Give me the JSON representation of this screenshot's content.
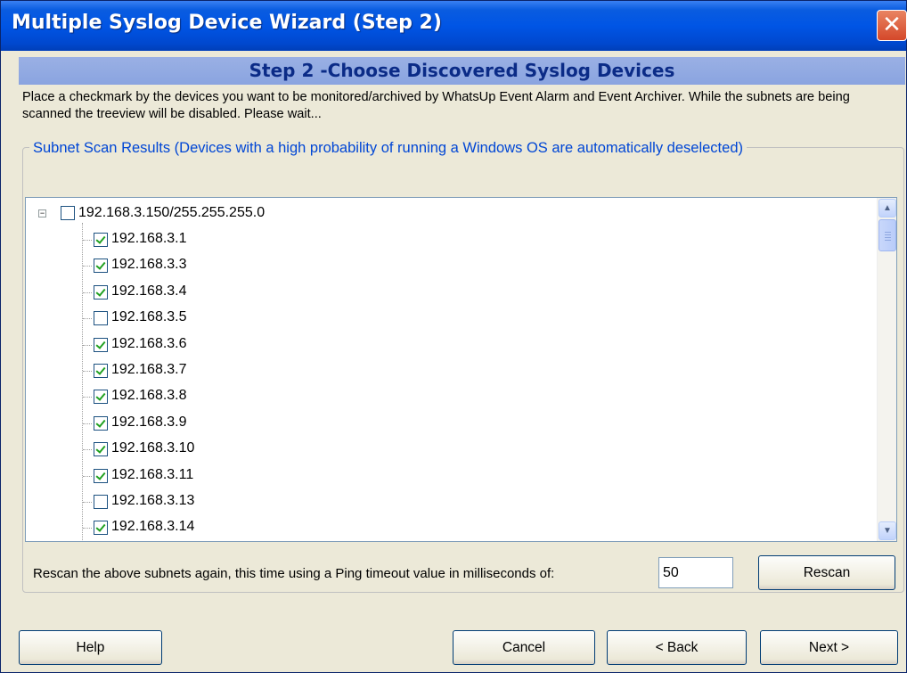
{
  "window": {
    "title": "Multiple Syslog Device Wizard (Step 2)",
    "close_glyph": "✕"
  },
  "step_banner": "Step 2 -Choose Discovered Syslog Devices",
  "instructions": "Place a checkmark by the devices you want to be monitored/archived by WhatsUp Event Alarm and Event Archiver. While the subnets are being scanned the treeview will be disabled.  Please wait...",
  "group": {
    "label": "Subnet Scan Results (Devices with a high probability of running a Windows OS are automatically deselected)"
  },
  "tree": {
    "root": {
      "label": "192.168.3.150/255.255.255.0",
      "checked": false,
      "expander": "⊟"
    },
    "devices": [
      {
        "ip": "192.168.3.1",
        "checked": true
      },
      {
        "ip": "192.168.3.3",
        "checked": true
      },
      {
        "ip": "192.168.3.4",
        "checked": true
      },
      {
        "ip": "192.168.3.5",
        "checked": false
      },
      {
        "ip": "192.168.3.6",
        "checked": true
      },
      {
        "ip": "192.168.3.7",
        "checked": true
      },
      {
        "ip": "192.168.3.8",
        "checked": true
      },
      {
        "ip": "192.168.3.9",
        "checked": true
      },
      {
        "ip": "192.168.3.10",
        "checked": true
      },
      {
        "ip": "192.168.3.11",
        "checked": true
      },
      {
        "ip": "192.168.3.13",
        "checked": false
      },
      {
        "ip": "192.168.3.14",
        "checked": true
      }
    ]
  },
  "scrollbar": {
    "up_glyph": "▲",
    "down_glyph": "▼"
  },
  "rescan": {
    "label": "Rescan the above subnets again, this time using a Ping timeout value in milliseconds of:",
    "ping_value": "50",
    "button": "Rescan"
  },
  "footer": {
    "help": "Help",
    "cancel": "Cancel",
    "back": "< Back",
    "next": "Next >"
  }
}
